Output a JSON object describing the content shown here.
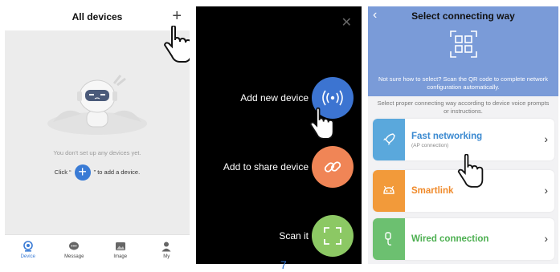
{
  "screen1": {
    "title": "All devices",
    "add_icon": "plus-icon",
    "empty_text": "You don't set up any devices yet.",
    "hint_before": "Click “",
    "hint_plus": "+",
    "hint_after": "” to add a device.",
    "tabs": [
      {
        "label": "Device",
        "icon": "webcam-icon",
        "active": true
      },
      {
        "label": "Message",
        "icon": "chat-icon",
        "active": false
      },
      {
        "label": "Image",
        "icon": "image-icon",
        "active": false
      },
      {
        "label": "My",
        "icon": "person-icon",
        "active": false
      }
    ],
    "colors": {
      "accent": "#3a7bd5"
    }
  },
  "screen2": {
    "close_icon": "close-icon",
    "actions": [
      {
        "label": "Add new device",
        "icon": "broadcast-icon",
        "color": "#3c74d1"
      },
      {
        "label": "Add to share device",
        "icon": "link-icon",
        "color": "#f08556"
      },
      {
        "label": "Scan it",
        "icon": "scan-frame-icon",
        "color": "#8cc864"
      }
    ],
    "page_number": "7"
  },
  "screen3": {
    "back_icon": "back-chevron-icon",
    "title": "Select connecting way",
    "qr_icon": "qr-code-icon",
    "qr_note": "Not sure how to select? Scan the QR code to complete network configuration automatically.",
    "instruction": "Select proper connecting way according to device voice prompts or instructions.",
    "options": [
      {
        "label": "Fast networking",
        "sub": "(AP connection)",
        "icon": "rocket-icon",
        "color": "#5aa8dc"
      },
      {
        "label": "Smartlink",
        "sub": "",
        "icon": "android-icon",
        "color": "#f29a3a"
      },
      {
        "label": "Wired connection",
        "sub": "",
        "icon": "cable-icon",
        "color": "#6cc070"
      }
    ]
  }
}
